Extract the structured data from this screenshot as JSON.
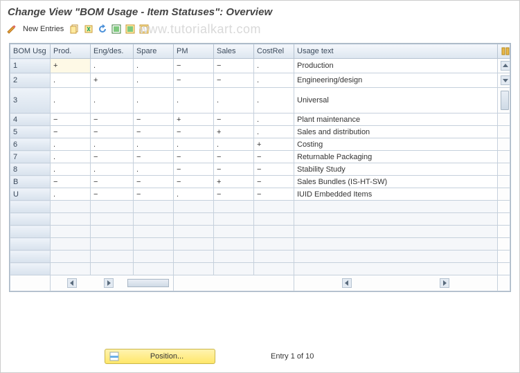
{
  "title": "Change View \"BOM Usage - Item Statuses\": Overview",
  "toolbar": {
    "new_entries": "New Entries"
  },
  "watermark": "www.tutorialkart.com",
  "columns": [
    "BOM Usg",
    "Prod.",
    "Eng/des.",
    "Spare",
    "PM",
    "Sales",
    "CostRel",
    "Usage text"
  ],
  "rows": [
    {
      "usg": "1",
      "prod": "+",
      "eng": ".",
      "spare": ".",
      "pm": "−",
      "sales": "−",
      "cost": ".",
      "text": "Production"
    },
    {
      "usg": "2",
      "prod": ".",
      "eng": "+",
      "spare": ".",
      "pm": "−",
      "sales": "−",
      "cost": ".",
      "text": "Engineering/design"
    },
    {
      "usg": "3",
      "prod": ".",
      "eng": ".",
      "spare": ".",
      "pm": ".",
      "sales": ".",
      "cost": ".",
      "text": "Universal"
    },
    {
      "usg": "4",
      "prod": "−",
      "eng": "−",
      "spare": "−",
      "pm": "+",
      "sales": "−",
      "cost": ".",
      "text": "Plant maintenance"
    },
    {
      "usg": "5",
      "prod": "−",
      "eng": "−",
      "spare": "−",
      "pm": "−",
      "sales": "+",
      "cost": ".",
      "text": "Sales and distribution"
    },
    {
      "usg": "6",
      "prod": ".",
      "eng": ".",
      "spare": ".",
      "pm": ".",
      "sales": ".",
      "cost": "+",
      "text": "Costing"
    },
    {
      "usg": "7",
      "prod": ".",
      "eng": "−",
      "spare": "−",
      "pm": "−",
      "sales": "−",
      "cost": "−",
      "text": "Returnable Packaging"
    },
    {
      "usg": "8",
      "prod": ".",
      "eng": ".",
      "spare": ".",
      "pm": "−",
      "sales": "−",
      "cost": "−",
      "text": "Stability Study"
    },
    {
      "usg": "B",
      "prod": "−",
      "eng": "−",
      "spare": "−",
      "pm": "−",
      "sales": "+",
      "cost": "−",
      "text": "Sales Bundles (IS-HT-SW)"
    },
    {
      "usg": "U",
      "prod": ".",
      "eng": "−",
      "spare": "−",
      "pm": ".",
      "sales": "−",
      "cost": "−",
      "text": "IUID Embedded Items"
    }
  ],
  "empty_rows": 6,
  "footer": {
    "position_label": "Position...",
    "entry_text": "Entry 1 of 10"
  }
}
